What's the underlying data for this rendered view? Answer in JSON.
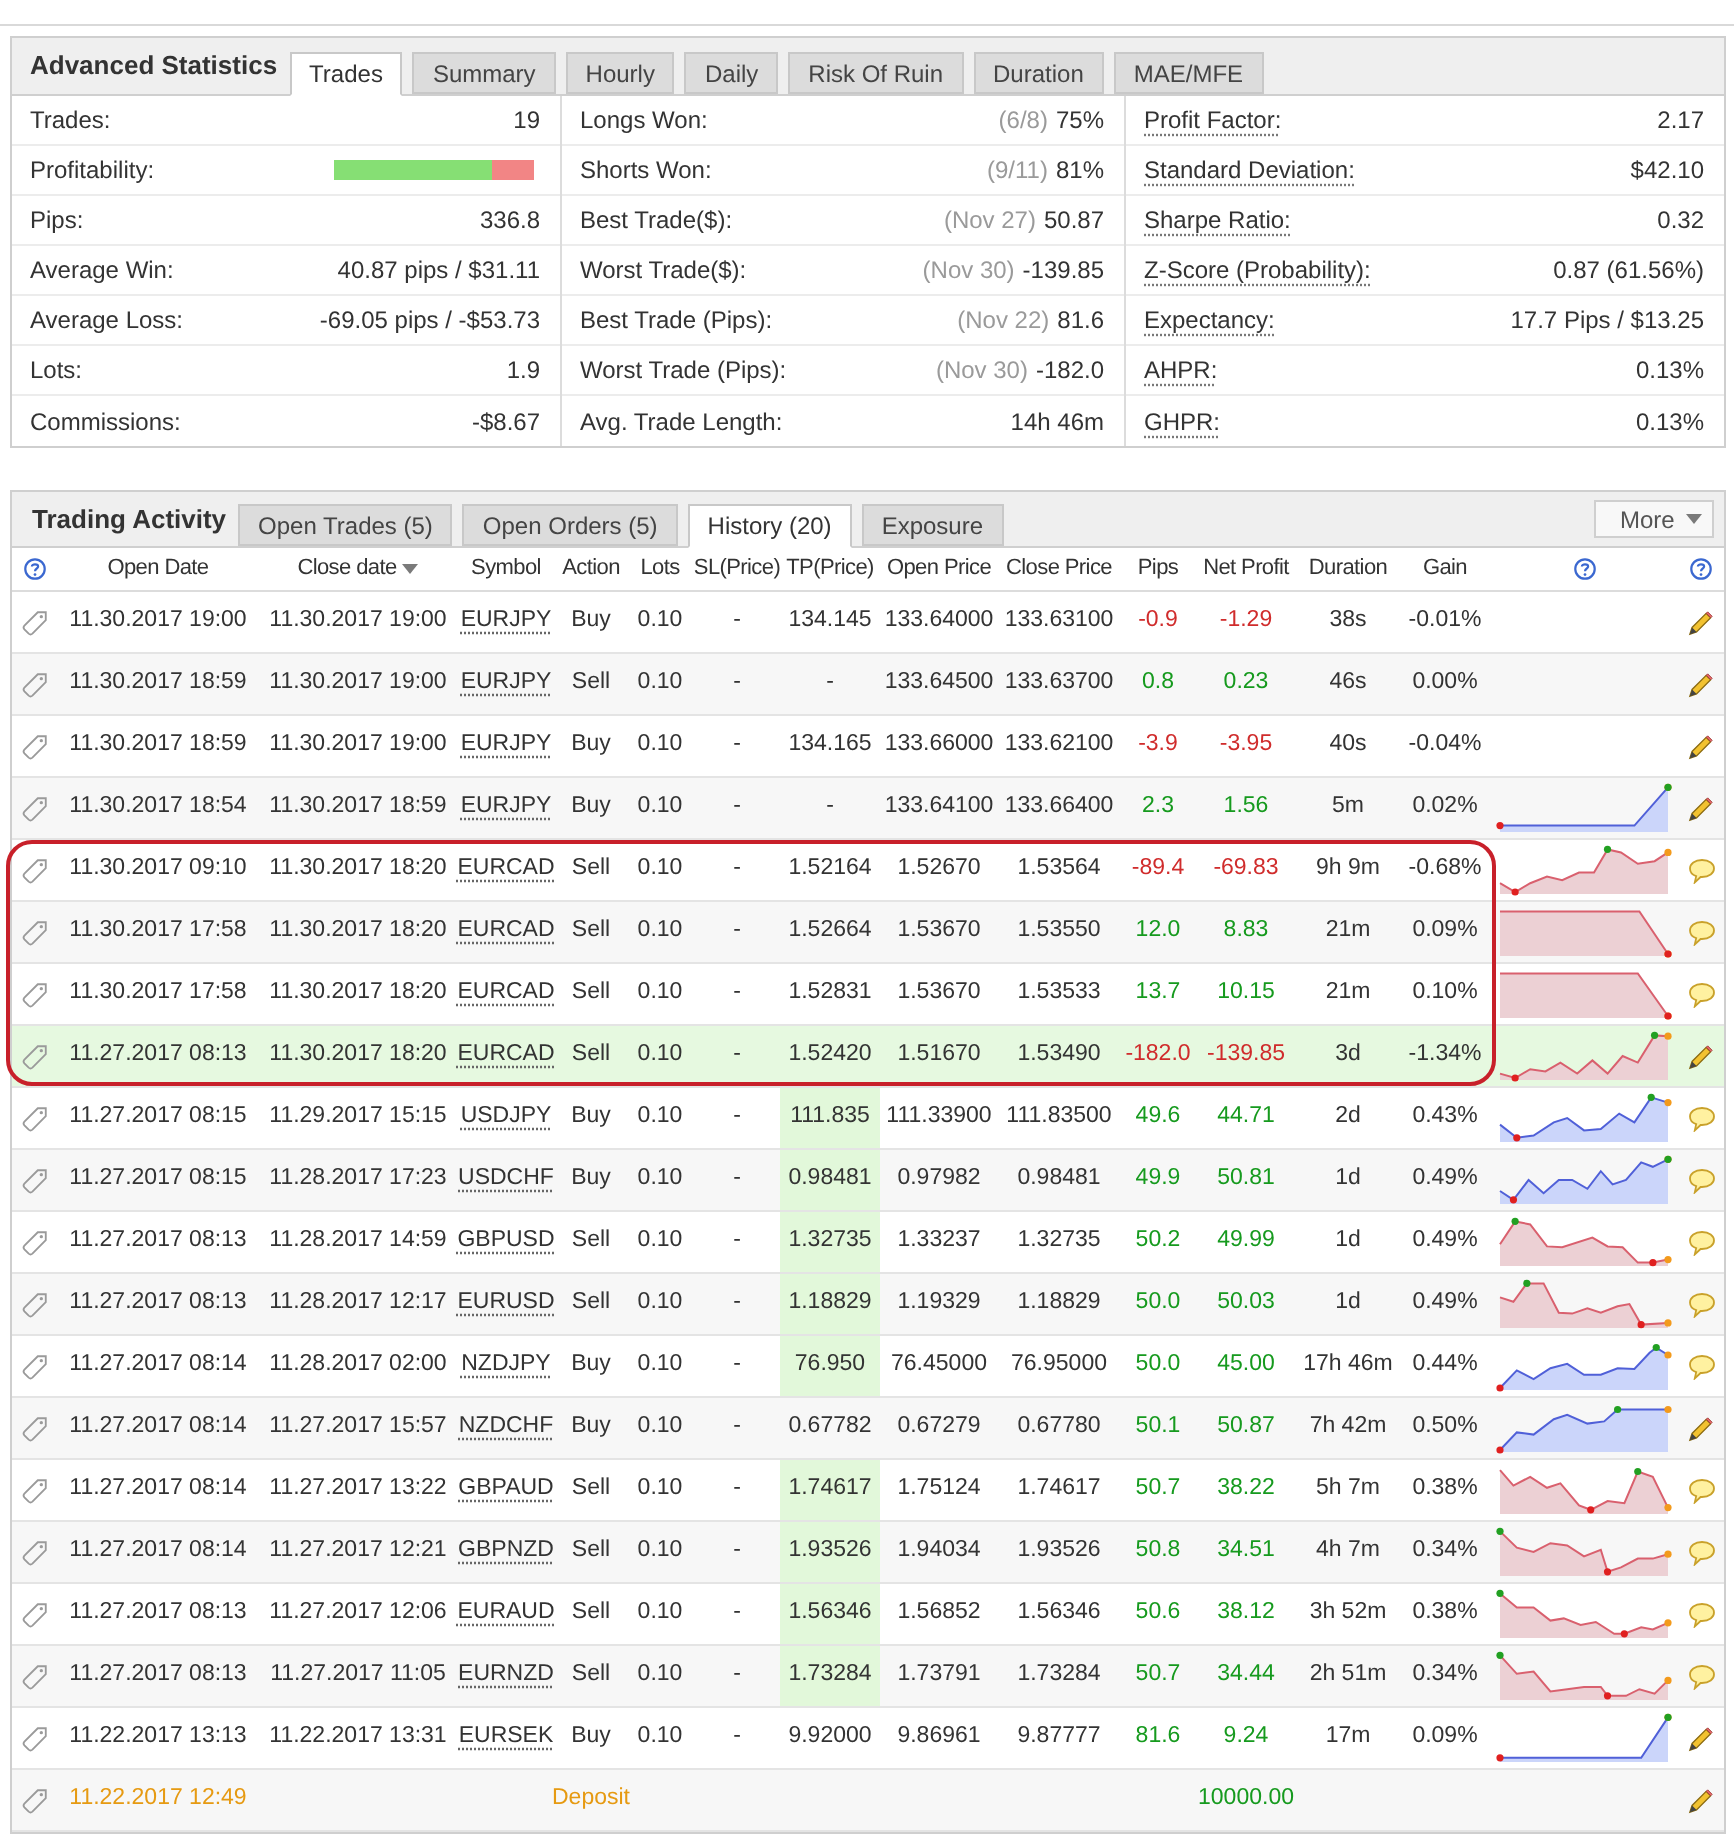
{
  "advanced_statistics": {
    "title": "Advanced Statistics",
    "tabs": [
      {
        "label": "Trades",
        "selected": true
      },
      {
        "label": "Summary",
        "selected": false
      },
      {
        "label": "Hourly",
        "selected": false
      },
      {
        "label": "Daily",
        "selected": false
      },
      {
        "label": "Risk Of Ruin",
        "selected": false
      },
      {
        "label": "Duration",
        "selected": false
      },
      {
        "label": "MAE/MFE",
        "selected": false
      }
    ],
    "columns": [
      {
        "has_tooltips": false,
        "rows": [
          {
            "kind": "text",
            "label": "Trades:",
            "value": "19"
          },
          {
            "kind": "bar",
            "label": "Profitability:",
            "level": 0.79
          },
          {
            "kind": "text",
            "label": "Pips:",
            "value": "336.8"
          },
          {
            "kind": "text",
            "label": "Average Win:",
            "value": "40.87 pips / $31.11"
          },
          {
            "kind": "text",
            "label": "Average Loss:",
            "value": "-69.05 pips / -$53.73"
          },
          {
            "kind": "text",
            "label": "Lots:",
            "value": "1.9"
          },
          {
            "kind": "text",
            "label": "Commissions:",
            "value": "-$8.67"
          }
        ]
      },
      {
        "has_tooltips": false,
        "rows": [
          {
            "kind": "text",
            "label": "Longs Won:",
            "note": "(6/8)",
            "value": "75%"
          },
          {
            "kind": "text",
            "label": "Shorts Won:",
            "note": "(9/11)",
            "value": "81%"
          },
          {
            "kind": "text",
            "label": "Best Trade($):",
            "note": "(Nov 27)",
            "value": "50.87"
          },
          {
            "kind": "text",
            "label": "Worst Trade($):",
            "note": "(Nov 30)",
            "value": "-139.85"
          },
          {
            "kind": "text",
            "label": "Best Trade (Pips):",
            "note": "(Nov 22)",
            "value": "81.6"
          },
          {
            "kind": "text",
            "label": "Worst Trade (Pips):",
            "note": "(Nov 30)",
            "value": "-182.0"
          },
          {
            "kind": "text",
            "label": "Avg. Trade Length:",
            "value": "14h 46m"
          }
        ]
      },
      {
        "has_tooltips": true,
        "rows": [
          {
            "kind": "text",
            "label": "Profit Factor:",
            "value": "2.17"
          },
          {
            "kind": "text",
            "label": "Standard Deviation:",
            "value": "$42.10"
          },
          {
            "kind": "text",
            "label": "Sharpe Ratio:",
            "value": "0.32"
          },
          {
            "kind": "text",
            "label": "Z-Score (Probability):",
            "value": "0.87 (61.56%)"
          },
          {
            "kind": "text",
            "label": "Expectancy:",
            "value": "17.7 Pips / $13.25"
          },
          {
            "kind": "text",
            "label": "AHPR:",
            "value": "0.13%"
          },
          {
            "kind": "text",
            "label": "GHPR:",
            "value": "0.13%"
          }
        ]
      }
    ]
  },
  "trading_activity": {
    "title": "Trading Activity",
    "tabs": [
      {
        "label": "Open Trades (5)",
        "selected": false
      },
      {
        "label": "Open Orders (5)",
        "selected": false
      },
      {
        "label": "History (20)",
        "selected": true
      },
      {
        "label": "Exposure",
        "selected": false
      }
    ],
    "more_button": "More",
    "columns": [
      {
        "label": "Open Date",
        "sorted": false
      },
      {
        "label": "Close date",
        "sorted": true
      },
      {
        "label": "Symbol",
        "sorted": false
      },
      {
        "label": "Action",
        "sorted": false
      },
      {
        "label": "Lots",
        "sorted": false
      },
      {
        "label": "SL(Price)",
        "sorted": false
      },
      {
        "label": "TP(Price)",
        "sorted": false
      },
      {
        "label": "Open Price",
        "sorted": false
      },
      {
        "label": "Close Price",
        "sorted": false
      },
      {
        "label": "Pips",
        "sorted": false
      },
      {
        "label": "Net Profit",
        "sorted": false
      },
      {
        "label": "Duration",
        "sorted": false
      },
      {
        "label": "Gain",
        "sorted": false
      }
    ],
    "rows": [
      {
        "kind": "trade",
        "open_date": "11.30.2017 19:00",
        "close_date": "11.30.2017 19:00",
        "symbol": "EURJPY",
        "action": "Buy",
        "lots": "0.10",
        "sl": "-",
        "tp": "134.145",
        "open_price": "133.64000",
        "close_price": "133.63100",
        "pips": "-0.9",
        "net_profit": "-1.29",
        "duration": "38s",
        "gain": "-0.01%",
        "loss": true,
        "tp_hit": false,
        "highlighted": false,
        "circled": false,
        "has_comment": false
      },
      {
        "kind": "trade",
        "open_date": "11.30.2017 18:59",
        "close_date": "11.30.2017 19:00",
        "symbol": "EURJPY",
        "action": "Sell",
        "lots": "0.10",
        "sl": "-",
        "tp": "-",
        "open_price": "133.64500",
        "close_price": "133.63700",
        "pips": "0.8",
        "net_profit": "0.23",
        "duration": "46s",
        "gain": "0.00%",
        "loss": false,
        "tp_hit": false,
        "highlighted": false,
        "circled": false,
        "has_comment": false
      },
      {
        "kind": "trade",
        "open_date": "11.30.2017 18:59",
        "close_date": "11.30.2017 19:00",
        "symbol": "EURJPY",
        "action": "Buy",
        "lots": "0.10",
        "sl": "-",
        "tp": "134.165",
        "open_price": "133.66000",
        "close_price": "133.62100",
        "pips": "-3.9",
        "net_profit": "-3.95",
        "duration": "40s",
        "gain": "-0.04%",
        "loss": true,
        "tp_hit": false,
        "highlighted": false,
        "circled": false,
        "has_comment": false
      },
      {
        "kind": "trade",
        "open_date": "11.30.2017 18:54",
        "close_date": "11.30.2017 18:59",
        "symbol": "EURJPY",
        "action": "Buy",
        "lots": "0.10",
        "sl": "-",
        "tp": "-",
        "open_price": "133.64100",
        "close_price": "133.66400",
        "pips": "2.3",
        "net_profit": "1.56",
        "duration": "5m",
        "gain": "0.02%",
        "loss": false,
        "tp_hit": false,
        "highlighted": false,
        "circled": false,
        "has_comment": false
      },
      {
        "kind": "trade",
        "open_date": "11.30.2017 09:10",
        "close_date": "11.30.2017 18:20",
        "symbol": "EURCAD",
        "action": "Sell",
        "lots": "0.10",
        "sl": "-",
        "tp": "1.52164",
        "open_price": "1.52670",
        "close_price": "1.53564",
        "pips": "-89.4",
        "net_profit": "-69.83",
        "duration": "9h 9m",
        "gain": "-0.68%",
        "loss": true,
        "tp_hit": false,
        "highlighted": false,
        "circled": true,
        "has_comment": true
      },
      {
        "kind": "trade",
        "open_date": "11.30.2017 17:58",
        "close_date": "11.30.2017 18:20",
        "symbol": "EURCAD",
        "action": "Sell",
        "lots": "0.10",
        "sl": "-",
        "tp": "1.52664",
        "open_price": "1.53670",
        "close_price": "1.53550",
        "pips": "12.0",
        "net_profit": "8.83",
        "duration": "21m",
        "gain": "0.09%",
        "loss": false,
        "tp_hit": false,
        "highlighted": false,
        "circled": true,
        "has_comment": true
      },
      {
        "kind": "trade",
        "open_date": "11.30.2017 17:58",
        "close_date": "11.30.2017 18:20",
        "symbol": "EURCAD",
        "action": "Sell",
        "lots": "0.10",
        "sl": "-",
        "tp": "1.52831",
        "open_price": "1.53670",
        "close_price": "1.53533",
        "pips": "13.7",
        "net_profit": "10.15",
        "duration": "21m",
        "gain": "0.10%",
        "loss": false,
        "tp_hit": false,
        "highlighted": false,
        "circled": true,
        "has_comment": true
      },
      {
        "kind": "trade",
        "open_date": "11.27.2017 08:13",
        "close_date": "11.30.2017 18:20",
        "symbol": "EURCAD",
        "action": "Sell",
        "lots": "0.10",
        "sl": "-",
        "tp": "1.52420",
        "open_price": "1.51670",
        "close_price": "1.53490",
        "pips": "-182.0",
        "net_profit": "-139.85",
        "duration": "3d",
        "gain": "-1.34%",
        "loss": true,
        "tp_hit": false,
        "highlighted": true,
        "circled": true,
        "has_comment": false
      },
      {
        "kind": "trade",
        "open_date": "11.27.2017 08:15",
        "close_date": "11.29.2017 15:15",
        "symbol": "USDJPY",
        "action": "Buy",
        "lots": "0.10",
        "sl": "-",
        "tp": "111.835",
        "open_price": "111.33900",
        "close_price": "111.83500",
        "pips": "49.6",
        "net_profit": "44.71",
        "duration": "2d",
        "gain": "0.43%",
        "loss": false,
        "tp_hit": true,
        "highlighted": false,
        "circled": false,
        "has_comment": true
      },
      {
        "kind": "trade",
        "open_date": "11.27.2017 08:15",
        "close_date": "11.28.2017 17:23",
        "symbol": "USDCHF",
        "action": "Buy",
        "lots": "0.10",
        "sl": "-",
        "tp": "0.98481",
        "open_price": "0.97982",
        "close_price": "0.98481",
        "pips": "49.9",
        "net_profit": "50.81",
        "duration": "1d",
        "gain": "0.49%",
        "loss": false,
        "tp_hit": true,
        "highlighted": false,
        "circled": false,
        "has_comment": true
      },
      {
        "kind": "trade",
        "open_date": "11.27.2017 08:13",
        "close_date": "11.28.2017 14:59",
        "symbol": "GBPUSD",
        "action": "Sell",
        "lots": "0.10",
        "sl": "-",
        "tp": "1.32735",
        "open_price": "1.33237",
        "close_price": "1.32735",
        "pips": "50.2",
        "net_profit": "49.99",
        "duration": "1d",
        "gain": "0.49%",
        "loss": false,
        "tp_hit": true,
        "highlighted": false,
        "circled": false,
        "has_comment": true
      },
      {
        "kind": "trade",
        "open_date": "11.27.2017 08:13",
        "close_date": "11.28.2017 12:17",
        "symbol": "EURUSD",
        "action": "Sell",
        "lots": "0.10",
        "sl": "-",
        "tp": "1.18829",
        "open_price": "1.19329",
        "close_price": "1.18829",
        "pips": "50.0",
        "net_profit": "50.03",
        "duration": "1d",
        "gain": "0.49%",
        "loss": false,
        "tp_hit": true,
        "highlighted": false,
        "circled": false,
        "has_comment": true
      },
      {
        "kind": "trade",
        "open_date": "11.27.2017 08:14",
        "close_date": "11.28.2017 02:00",
        "symbol": "NZDJPY",
        "action": "Buy",
        "lots": "0.10",
        "sl": "-",
        "tp": "76.950",
        "open_price": "76.45000",
        "close_price": "76.95000",
        "pips": "50.0",
        "net_profit": "45.00",
        "duration": "17h 46m",
        "gain": "0.44%",
        "loss": false,
        "tp_hit": true,
        "highlighted": false,
        "circled": false,
        "has_comment": true
      },
      {
        "kind": "trade",
        "open_date": "11.27.2017 08:14",
        "close_date": "11.27.2017 15:57",
        "symbol": "NZDCHF",
        "action": "Buy",
        "lots": "0.10",
        "sl": "-",
        "tp": "0.67782",
        "open_price": "0.67279",
        "close_price": "0.67780",
        "pips": "50.1",
        "net_profit": "50.87",
        "duration": "7h 42m",
        "gain": "0.50%",
        "loss": false,
        "tp_hit": false,
        "highlighted": false,
        "circled": false,
        "has_comment": false
      },
      {
        "kind": "trade",
        "open_date": "11.27.2017 08:14",
        "close_date": "11.27.2017 13:22",
        "symbol": "GBPAUD",
        "action": "Sell",
        "lots": "0.10",
        "sl": "-",
        "tp": "1.74617",
        "open_price": "1.75124",
        "close_price": "1.74617",
        "pips": "50.7",
        "net_profit": "38.22",
        "duration": "5h 7m",
        "gain": "0.38%",
        "loss": false,
        "tp_hit": true,
        "highlighted": false,
        "circled": false,
        "has_comment": true
      },
      {
        "kind": "trade",
        "open_date": "11.27.2017 08:14",
        "close_date": "11.27.2017 12:21",
        "symbol": "GBPNZD",
        "action": "Sell",
        "lots": "0.10",
        "sl": "-",
        "tp": "1.93526",
        "open_price": "1.94034",
        "close_price": "1.93526",
        "pips": "50.8",
        "net_profit": "34.51",
        "duration": "4h 7m",
        "gain": "0.34%",
        "loss": false,
        "tp_hit": true,
        "highlighted": false,
        "circled": false,
        "has_comment": true
      },
      {
        "kind": "trade",
        "open_date": "11.27.2017 08:13",
        "close_date": "11.27.2017 12:06",
        "symbol": "EURAUD",
        "action": "Sell",
        "lots": "0.10",
        "sl": "-",
        "tp": "1.56346",
        "open_price": "1.56852",
        "close_price": "1.56346",
        "pips": "50.6",
        "net_profit": "38.12",
        "duration": "3h 52m",
        "gain": "0.38%",
        "loss": false,
        "tp_hit": true,
        "highlighted": false,
        "circled": false,
        "has_comment": true
      },
      {
        "kind": "trade",
        "open_date": "11.27.2017 08:13",
        "close_date": "11.27.2017 11:05",
        "symbol": "EURNZD",
        "action": "Sell",
        "lots": "0.10",
        "sl": "-",
        "tp": "1.73284",
        "open_price": "1.73791",
        "close_price": "1.73284",
        "pips": "50.7",
        "net_profit": "34.44",
        "duration": "2h 51m",
        "gain": "0.34%",
        "loss": false,
        "tp_hit": true,
        "highlighted": false,
        "circled": false,
        "has_comment": true
      },
      {
        "kind": "trade",
        "open_date": "11.22.2017 13:13",
        "close_date": "11.22.2017 13:31",
        "symbol": "EURSEK",
        "action": "Buy",
        "lots": "0.10",
        "sl": "-",
        "tp": "9.92000",
        "open_price": "9.86961",
        "close_price": "9.87777",
        "pips": "81.6",
        "net_profit": "9.24",
        "duration": "17m",
        "gain": "0.09%",
        "loss": false,
        "tp_hit": false,
        "highlighted": false,
        "circled": false,
        "has_comment": false
      },
      {
        "kind": "deposit",
        "open_date": "11.22.2017 12:49",
        "action": "Deposit",
        "net_profit": "10000.00",
        "loss": false,
        "tp_hit": false,
        "highlighted": false,
        "circled": false,
        "has_comment": false
      }
    ]
  }
}
